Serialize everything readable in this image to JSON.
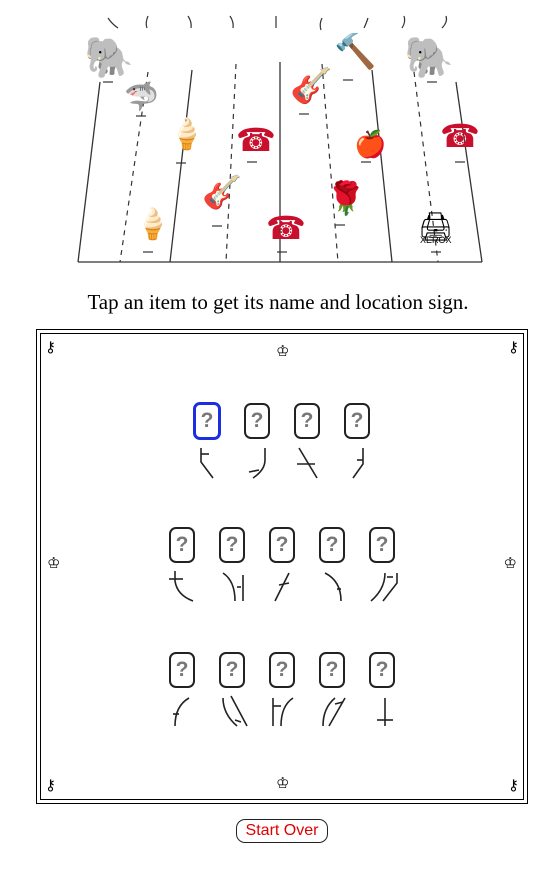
{
  "instruction": "Tap an item to get its name and location sign.",
  "scene": {
    "items": [
      {
        "name": "elephant-left",
        "icon": "elephant-icon",
        "glyph": "🐘"
      },
      {
        "name": "shark",
        "icon": "shark-icon",
        "glyph": "🦈"
      },
      {
        "name": "ice-cream-upper",
        "icon": "ice-cream-icon",
        "glyph": "🍦"
      },
      {
        "name": "ice-cream-lower",
        "icon": "ice-cream-icon",
        "glyph": "🍦"
      },
      {
        "name": "guitar-left",
        "icon": "guitar-icon",
        "glyph": "🎸"
      },
      {
        "name": "telephone-left",
        "icon": "telephone-icon",
        "glyph": "☎"
      },
      {
        "name": "telephone-center",
        "icon": "telephone-icon",
        "glyph": "☎"
      },
      {
        "name": "guitar-center",
        "icon": "guitar-icon",
        "glyph": "🎸"
      },
      {
        "name": "hammer",
        "icon": "hammer-icon",
        "glyph": "🔨"
      },
      {
        "name": "apple",
        "icon": "apple-icon",
        "glyph": "🍎"
      },
      {
        "name": "rose",
        "icon": "rose-icon",
        "glyph": "🌹"
      },
      {
        "name": "elephant-right",
        "icon": "elephant-icon",
        "glyph": "🐘"
      },
      {
        "name": "telephone-right",
        "icon": "telephone-icon",
        "glyph": "☎"
      },
      {
        "name": "copier",
        "icon": "copier-icon",
        "glyph": "🖨"
      },
      {
        "name": "copier-label",
        "icon": "copier-icon",
        "glyph": "XEROX"
      }
    ]
  },
  "board": {
    "corner_icon": "key-icon",
    "corner_glyph": "⚷",
    "edge_icon": "crown-icon",
    "edge_glyph": "♔",
    "card_glyph": "?",
    "rows": [
      {
        "count": 4,
        "selected_index": 0
      },
      {
        "count": 5,
        "selected_index": -1
      },
      {
        "count": 5,
        "selected_index": -1
      }
    ]
  },
  "controls": {
    "start_over_label": "Start Over",
    "start_over_color": "#e00000",
    "selected_color": "#1b2fe0"
  }
}
